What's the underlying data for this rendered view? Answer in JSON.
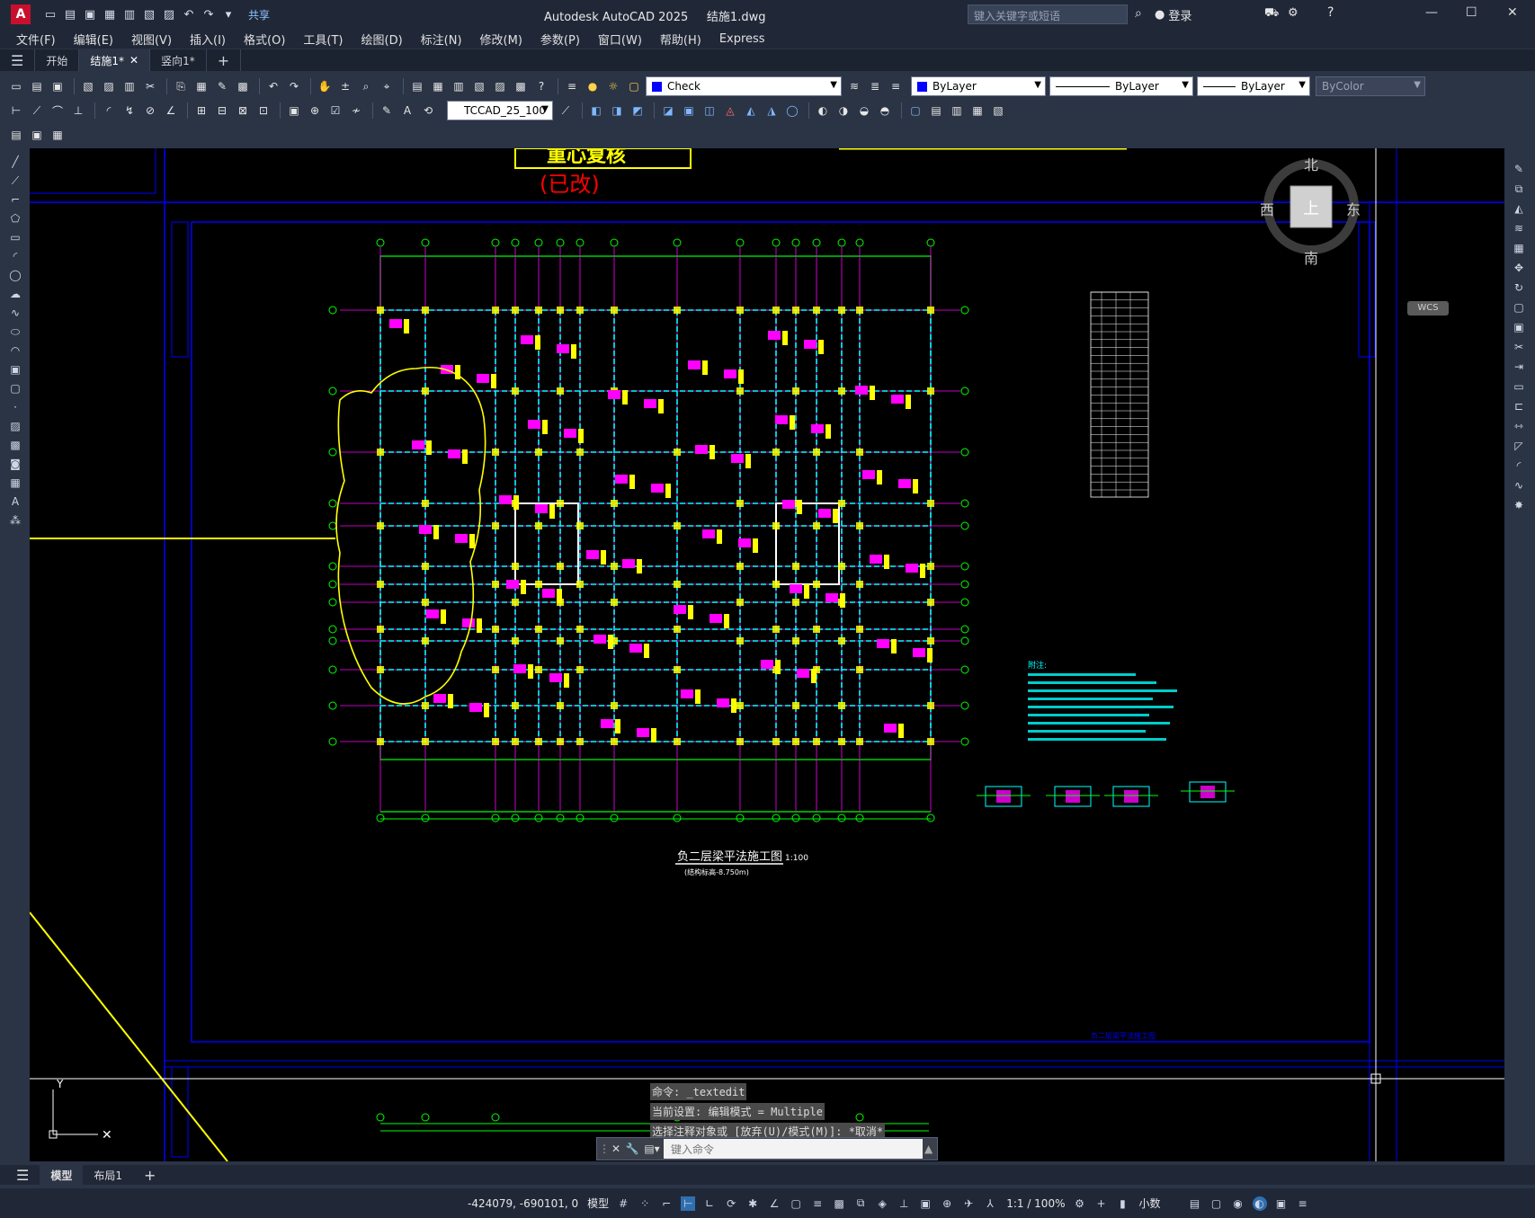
{
  "title": {
    "app": "Autodesk AutoCAD 2025",
    "file": "结施1.dwg",
    "search_placeholder": "键入关键字或短语",
    "login": "登录",
    "share": "共享"
  },
  "menu": [
    "文件(F)",
    "编辑(E)",
    "视图(V)",
    "插入(I)",
    "格式(O)",
    "工具(T)",
    "绘图(D)",
    "标注(N)",
    "修改(M)",
    "参数(P)",
    "窗口(W)",
    "帮助(H)",
    "Express"
  ],
  "file_tabs": [
    {
      "label": "开始",
      "active": false
    },
    {
      "label": "结施1*",
      "active": true
    },
    {
      "label": "竖向1*",
      "active": false
    }
  ],
  "toolbar": {
    "layer": "Check",
    "color": "ByLayer",
    "linetype": "ByLayer",
    "lineweight": "ByLayer",
    "plotstyle": "ByColor",
    "textstyle": "TCCAD_25_100"
  },
  "drawing": {
    "banner_top": "重心复核",
    "banner_revised": "(已改)",
    "plan_title": "负二层梁平法施工图",
    "plan_scale": "1:100",
    "plan_subtitle": "(结构标高-8.750m)",
    "notes_title": "附注:",
    "frame_label": "负二层梁平法施工图"
  },
  "viewcube": {
    "north": "北",
    "south": "南",
    "east": "东",
    "west": "西",
    "face": "上",
    "wcs": "WCS"
  },
  "command": {
    "history": [
      "命令: _textedit",
      "当前设置: 编辑模式 = Multiple",
      "选择注释对象或 [放弃(U)/模式(M)]: *取消*"
    ],
    "placeholder": "键入命令"
  },
  "layout_tabs": [
    {
      "label": "模型",
      "active": true
    },
    {
      "label": "布局1",
      "active": false
    }
  ],
  "status": {
    "coords": "-424079, -690101, 0",
    "model": "模型",
    "scale": "1:1 / 100%",
    "units": "小数"
  },
  "colors": {
    "canvas_bg": "#000000",
    "frame_blue": "#0000ff",
    "grid_green": "#00ff00",
    "beam_cyan": "#00ffff",
    "label_magenta": "#ff00ff",
    "column_yellow": "#ffff00",
    "accent_red": "#ff0000"
  }
}
